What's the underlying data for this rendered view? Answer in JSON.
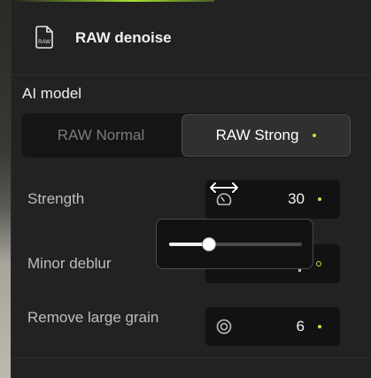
{
  "header": {
    "title": "RAW denoise",
    "icon": "raw-file-icon",
    "icon_text": "RAW"
  },
  "ai_model": {
    "label": "AI model",
    "options": [
      {
        "label": "RAW Normal",
        "selected": false
      },
      {
        "label": "RAW Strong",
        "selected": true
      }
    ]
  },
  "controls": {
    "strength": {
      "label": "Strength",
      "value": "30",
      "icon": "gauge-icon",
      "indicator": "dot"
    },
    "minor_deblur": {
      "label": "Minor deblur",
      "indicator": "ring"
    },
    "remove_large_grain": {
      "label": "Remove large grain",
      "value": "6",
      "icon": "target-icon",
      "indicator": "dot"
    }
  },
  "popover_slider": {
    "level": 0.3
  },
  "colors": {
    "accent": "#b8ea3f",
    "panel": "#222222",
    "field": "#121212"
  }
}
